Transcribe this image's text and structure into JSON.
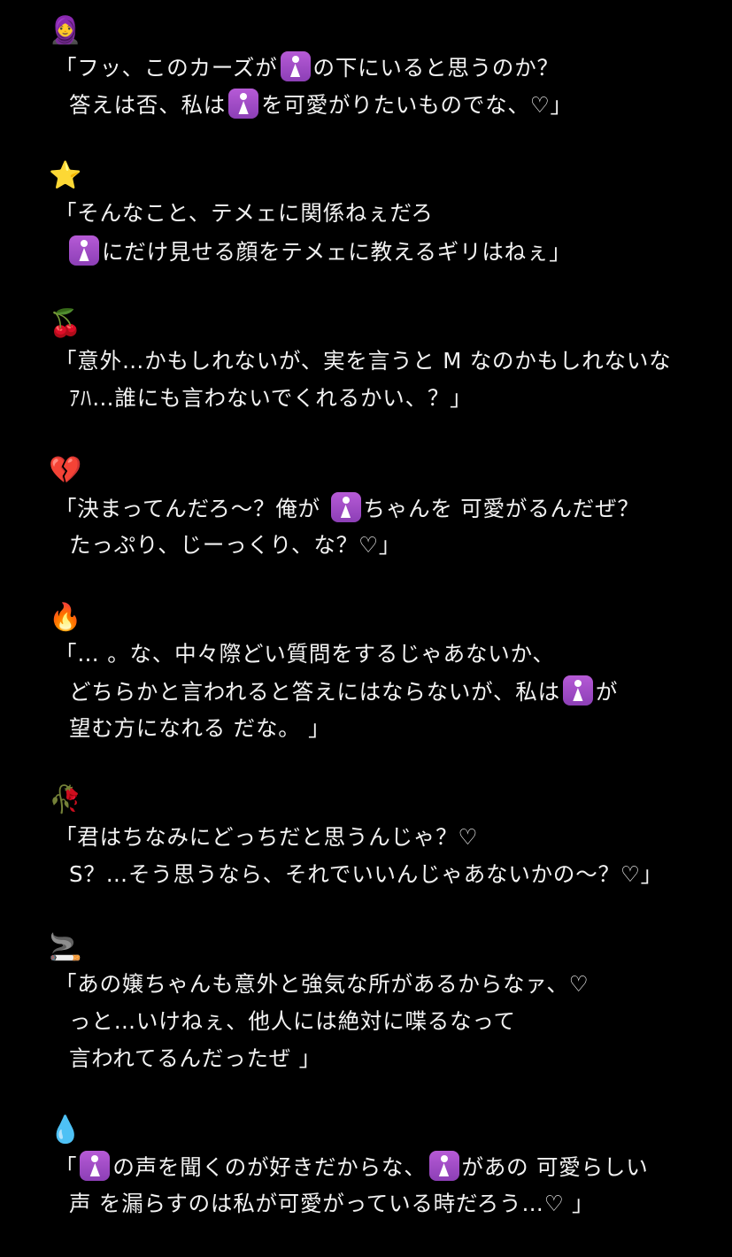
{
  "entries": [
    {
      "emoji": "🧕",
      "lines": [
        [
          "「フッ、このカーズが",
          "chip",
          "の下にいると思うのか？"
        ],
        [
          "答えは否、私は",
          "chip",
          "を可愛がりたいものでな、♡」"
        ]
      ]
    },
    {
      "emoji": "⭐",
      "lines": [
        [
          "「そんなこと、テメェに関係ねぇだろ"
        ],
        [
          "chip",
          "にだけ見せる顔をテメェに教えるギリはねぇ」"
        ]
      ]
    },
    {
      "emoji": "🍒",
      "lines": [
        [
          "「意外…かもしれないが、実を言うと M なのかもしれないな"
        ],
        [
          "ｱﾊ…誰にも言わないでくれるかい、？」"
        ]
      ]
    },
    {
      "emoji": "💔",
      "lines": [
        [
          "「決まってんだろ〜？俺が ",
          "chip",
          "ちゃんを 可愛がるんだぜ？"
        ],
        [
          "たっぷり、じーっくり、な？♡」"
        ]
      ]
    },
    {
      "emoji": "🔥",
      "lines": [
        [
          "「… 。な、中々際どい質問をするじゃあないか、"
        ],
        [
          "どちらかと言われると答えにはならないが、私は",
          "chip",
          "が"
        ],
        [
          "望む方になれる だな。 」"
        ]
      ]
    },
    {
      "emoji": "🥀",
      "lines": [
        [
          "「君はちなみにどっちだと思うんじゃ？♡"
        ],
        [
          "S？…そう思うなら、それでいいんじゃあないかの〜？♡」"
        ]
      ]
    },
    {
      "emoji": "🚬",
      "lines": [
        [
          "「あの嬢ちゃんも意外と強気な所があるからなァ、♡"
        ],
        [
          "っと…いけねぇ、他人には絶対に喋るなって"
        ],
        [
          "言われてるんだったぜ 」"
        ]
      ]
    },
    {
      "emoji": "💧",
      "lines": [
        [
          "「",
          "chip",
          "の声を聞くのが好きだからな、",
          "chip",
          "があの 可愛らしい"
        ],
        [
          "声 を漏らすのは私が可愛がっている時だろう…♡ 」"
        ]
      ]
    }
  ]
}
